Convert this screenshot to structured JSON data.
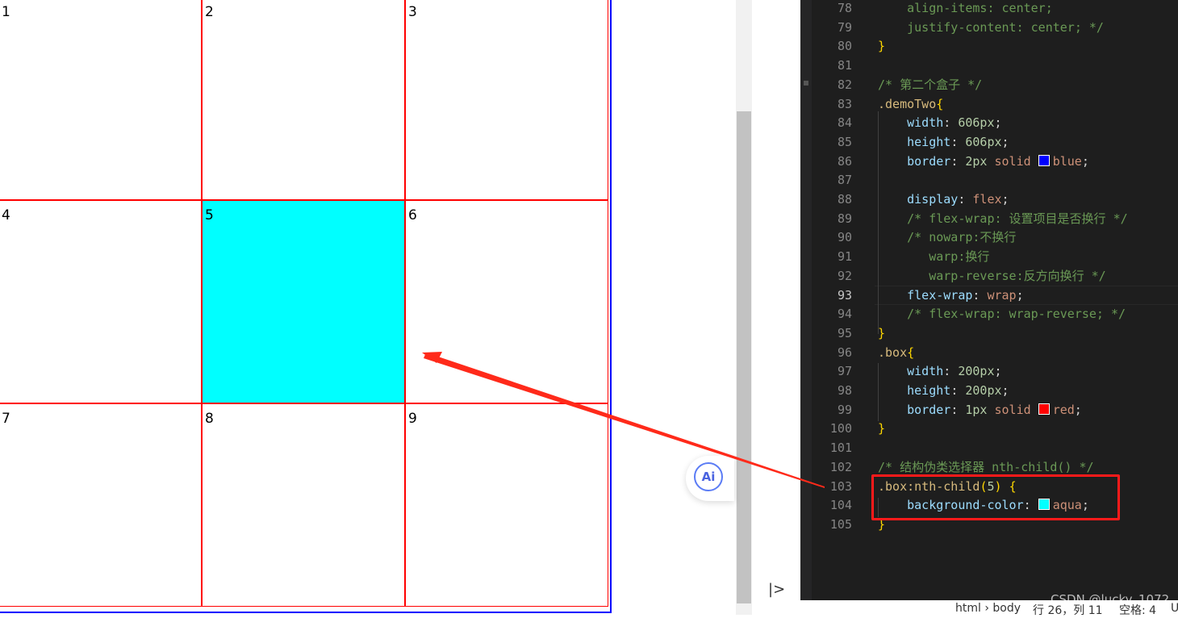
{
  "boxes": [
    "1",
    "2",
    "3",
    "4",
    "5",
    "6",
    "7",
    "8",
    "9"
  ],
  "active_box": 5,
  "colors": {
    "box_border": "#ff0000",
    "container_border": "#0000ff",
    "active_bg": "#00ffff",
    "annotation": "#ff1a1a"
  },
  "ai_button": {
    "label": "Ai"
  },
  "expand_button": {
    "label": "|>"
  },
  "code_lines": [
    {
      "n": "78",
      "parts": [
        [
          "c",
          "    align-items: center;"
        ]
      ]
    },
    {
      "n": "79",
      "parts": [
        [
          "c",
          "    justify-content: center; */"
        ]
      ]
    },
    {
      "n": "80",
      "parts": [
        [
          "br",
          "}"
        ]
      ]
    },
    {
      "n": "81",
      "parts": []
    },
    {
      "n": "82",
      "parts": [
        [
          "c",
          "/* 第二个盒子 */"
        ]
      ]
    },
    {
      "n": "83",
      "parts": [
        [
          "sel",
          ".demoTwo"
        ],
        [
          "br",
          "{"
        ]
      ]
    },
    {
      "n": "84",
      "parts": [
        [
          "prop",
          "    width"
        ],
        [
          "punct",
          ": "
        ],
        [
          "num",
          "606px"
        ],
        [
          "punct",
          ";"
        ]
      ]
    },
    {
      "n": "85",
      "parts": [
        [
          "prop",
          "    height"
        ],
        [
          "punct",
          ": "
        ],
        [
          "num",
          "606px"
        ],
        [
          "punct",
          ";"
        ]
      ]
    },
    {
      "n": "86",
      "parts": [
        [
          "prop",
          "    border"
        ],
        [
          "punct",
          ": "
        ],
        [
          "num",
          "2px"
        ],
        [
          "punct",
          " "
        ],
        [
          "val",
          "solid "
        ],
        [
          "swatch",
          "#0000ff"
        ],
        [
          "val",
          "blue"
        ],
        [
          "punct",
          ";"
        ]
      ]
    },
    {
      "n": "87",
      "parts": []
    },
    {
      "n": "88",
      "parts": [
        [
          "prop",
          "    display"
        ],
        [
          "punct",
          ": "
        ],
        [
          "val",
          "flex"
        ],
        [
          "punct",
          ";"
        ]
      ]
    },
    {
      "n": "89",
      "parts": [
        [
          "c",
          "    /* flex-wrap: 设置项目是否换行 */"
        ]
      ]
    },
    {
      "n": "90",
      "parts": [
        [
          "c",
          "    /* nowarp:不换行"
        ]
      ]
    },
    {
      "n": "91",
      "parts": [
        [
          "c",
          "       warp:换行"
        ]
      ]
    },
    {
      "n": "92",
      "parts": [
        [
          "c",
          "       warp-reverse:反方向换行 */"
        ]
      ]
    },
    {
      "n": "93",
      "parts": [
        [
          "prop",
          "    flex-wrap"
        ],
        [
          "punct",
          ": "
        ],
        [
          "val",
          "wrap"
        ],
        [
          "punct",
          ";"
        ]
      ],
      "current": true
    },
    {
      "n": "94",
      "parts": [
        [
          "c",
          "    /* flex-wrap: wrap-reverse; */"
        ]
      ]
    },
    {
      "n": "95",
      "parts": [
        [
          "br",
          "}"
        ]
      ]
    },
    {
      "n": "96",
      "parts": [
        [
          "sel",
          ".box"
        ],
        [
          "br",
          "{"
        ]
      ]
    },
    {
      "n": "97",
      "parts": [
        [
          "prop",
          "    width"
        ],
        [
          "punct",
          ": "
        ],
        [
          "num",
          "200px"
        ],
        [
          "punct",
          ";"
        ]
      ]
    },
    {
      "n": "98",
      "parts": [
        [
          "prop",
          "    height"
        ],
        [
          "punct",
          ": "
        ],
        [
          "num",
          "200px"
        ],
        [
          "punct",
          ";"
        ]
      ]
    },
    {
      "n": "99",
      "parts": [
        [
          "prop",
          "    border"
        ],
        [
          "punct",
          ": "
        ],
        [
          "num",
          "1px"
        ],
        [
          "punct",
          " "
        ],
        [
          "val",
          "solid "
        ],
        [
          "swatch",
          "#ff0000"
        ],
        [
          "val",
          "red"
        ],
        [
          "punct",
          ";"
        ]
      ]
    },
    {
      "n": "100",
      "parts": [
        [
          "br",
          "}"
        ]
      ]
    },
    {
      "n": "101",
      "parts": []
    },
    {
      "n": "102",
      "parts": [
        [
          "c",
          "/* 结构伪类选择器 nth-child() */"
        ]
      ]
    },
    {
      "n": "103",
      "parts": [
        [
          "sel",
          ".box:nth-child"
        ],
        [
          "br",
          "("
        ],
        [
          "num",
          "5"
        ],
        [
          "br",
          ")"
        ],
        [
          "punct",
          " "
        ],
        [
          "br",
          "{"
        ]
      ]
    },
    {
      "n": "104",
      "parts": [
        [
          "prop",
          "    background-color"
        ],
        [
          "punct",
          ": "
        ],
        [
          "swatch",
          "#00ffff"
        ],
        [
          "val",
          "aqua"
        ],
        [
          "punct",
          ";"
        ]
      ]
    },
    {
      "n": "105",
      "parts": [
        [
          "br",
          "}"
        ]
      ]
    }
  ],
  "watermark": "CSDN @lucky_1072",
  "status": {
    "breadcrumb": "html › body",
    "position": "行 26，列 11",
    "indent": "空格: 4",
    "encoding": "U"
  }
}
